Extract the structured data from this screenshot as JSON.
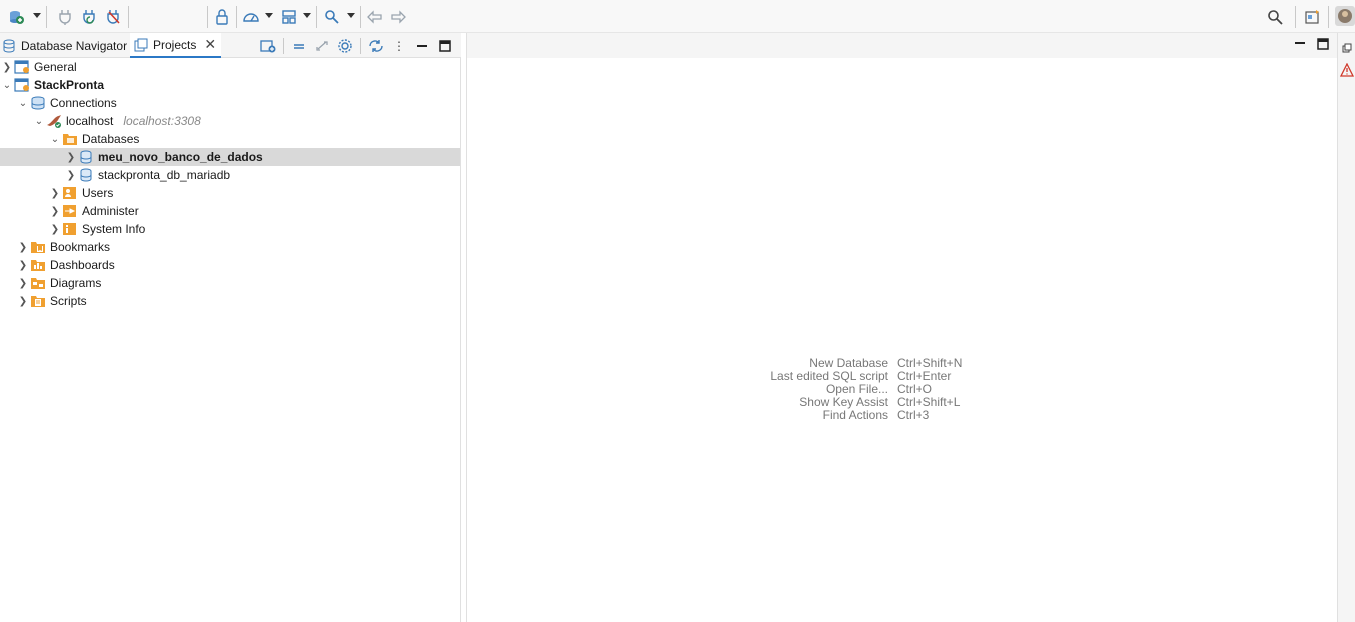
{
  "toolbar": {
    "icons": [
      "new-connection-icon",
      "connect-icon",
      "reconnect-icon",
      "disconnect-icon",
      "transaction-mode-icon",
      "commit-icon",
      "rollback-icon",
      "search-icon",
      "navigate-back-icon",
      "navigate-forward-icon",
      "global-search-icon",
      "perspective-icon",
      "avatar"
    ]
  },
  "left_panel": {
    "tabs": [
      {
        "label": "Database Navigator",
        "active": false
      },
      {
        "label": "Projects",
        "active": true
      }
    ]
  },
  "tree": [
    {
      "label": "General",
      "level": 0,
      "expanded": false,
      "bold": false,
      "icon": "project-icon"
    },
    {
      "label": "StackPronta",
      "level": 0,
      "expanded": true,
      "bold": true,
      "icon": "project-icon"
    },
    {
      "label": "Connections",
      "level": 1,
      "expanded": true,
      "bold": false,
      "icon": "connections-icon"
    },
    {
      "label": "localhost",
      "hint": "localhost:3308",
      "level": 2,
      "expanded": true,
      "bold": false,
      "icon": "mariadb-connection-icon"
    },
    {
      "label": "Databases",
      "level": 3,
      "expanded": true,
      "bold": false,
      "icon": "folder-icon"
    },
    {
      "label": "meu_novo_banco_de_dados",
      "level": 4,
      "expanded": false,
      "bold": true,
      "selected": true,
      "icon": "database-icon"
    },
    {
      "label": "stackpronta_db_mariadb",
      "level": 4,
      "expanded": false,
      "bold": false,
      "icon": "database-icon"
    },
    {
      "label": "Users",
      "level": 3,
      "expanded": false,
      "bold": false,
      "icon": "users-folder-icon"
    },
    {
      "label": "Administer",
      "level": 3,
      "expanded": false,
      "bold": false,
      "icon": "admin-folder-icon"
    },
    {
      "label": "System Info",
      "level": 3,
      "expanded": false,
      "bold": false,
      "icon": "info-folder-icon"
    },
    {
      "label": "Bookmarks",
      "level": 1,
      "expanded": false,
      "bold": false,
      "icon": "bookmarks-folder-icon"
    },
    {
      "label": "Dashboards",
      "level": 1,
      "expanded": false,
      "bold": false,
      "icon": "dashboards-folder-icon"
    },
    {
      "label": "Diagrams",
      "level": 1,
      "expanded": false,
      "bold": false,
      "icon": "diagrams-folder-icon"
    },
    {
      "label": "Scripts",
      "level": 1,
      "expanded": false,
      "bold": false,
      "icon": "scripts-folder-icon"
    }
  ],
  "shortcuts": [
    {
      "label": "New Database",
      "key": "Ctrl+Shift+N"
    },
    {
      "label": "Last edited SQL script",
      "key": "Ctrl+Enter"
    },
    {
      "label": "Open File...",
      "key": "Ctrl+O"
    },
    {
      "label": "Show Key Assist",
      "key": "Ctrl+Shift+L"
    },
    {
      "label": "Find Actions",
      "key": "Ctrl+3"
    }
  ],
  "colors": {
    "accent": "#2b78c6",
    "folder": "#f0a030",
    "selected_row": "#d9d9d9",
    "warning": "#d0392b"
  }
}
